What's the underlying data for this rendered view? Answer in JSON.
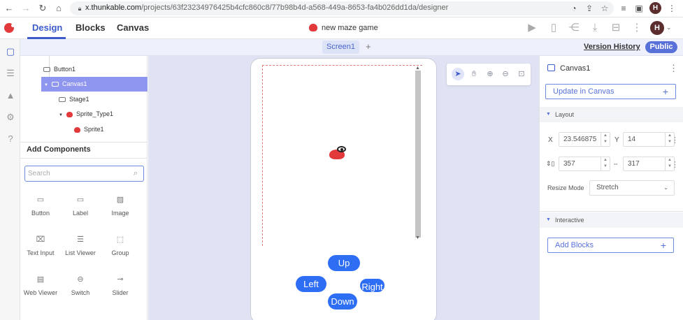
{
  "browser": {
    "url_host": "x.thunkable.com",
    "url_path": "/projects/63f23234976425b4cfc860c8/77b98b4d-a568-449a-8653-fa4b026dd1da/designer",
    "avatar_letter": "H"
  },
  "header": {
    "tabs": [
      "Design",
      "Blocks",
      "Canvas"
    ],
    "active_tab": "Design",
    "project_name": "new maze game",
    "avatar_letter": "H"
  },
  "screen_bar": {
    "screen_tab": "Screen1",
    "add_label": "+",
    "version_history": "Version History",
    "public_label": "Public"
  },
  "tree": {
    "items": [
      {
        "label": "Button1"
      },
      {
        "label": "Canvas1"
      },
      {
        "label": "Stage1"
      },
      {
        "label": "Sprite_Type1"
      },
      {
        "label": "Sprite1"
      }
    ]
  },
  "components": {
    "title": "Add Components",
    "search_placeholder": "Search",
    "items": [
      "Button",
      "Label",
      "Image",
      "Text Input",
      "List Viewer",
      "Group",
      "Web Viewer",
      "Switch",
      "Slider"
    ]
  },
  "controls": {
    "up": "Up",
    "left": "Left",
    "right": "Right",
    "down": "Down"
  },
  "properties": {
    "title": "Canvas1",
    "update_button": "Update in Canvas",
    "layout_section": "Layout",
    "x_label": "X",
    "x_value": "23.546875",
    "y_label": "Y",
    "y_value": "14",
    "width_value": "357",
    "height_value": "317",
    "resize_label": "Resize Mode",
    "resize_value": "Stretch",
    "interactive_section": "Interactive",
    "add_blocks_button": "Add Blocks"
  },
  "colors": {
    "accent": "#3d5ccc",
    "button_blue": "#2d6ef5",
    "selected_row": "#8f96f0",
    "brand_red": "#e23a3a"
  }
}
